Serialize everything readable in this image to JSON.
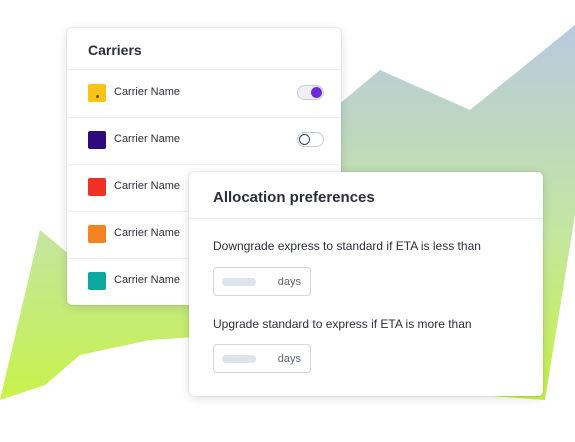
{
  "carriers": {
    "title": "Carriers",
    "items": [
      {
        "label": "Carrier Name",
        "color": "#f9c417",
        "toggle": true
      },
      {
        "label": "Carrier Name",
        "color": "#2e0a7d",
        "toggle": false
      },
      {
        "label": "Carrier Name",
        "color": "#ee3124"
      },
      {
        "label": "Carrier Name",
        "color": "#f58220"
      },
      {
        "label": "Carrier Name",
        "color": "#0aa89e"
      }
    ]
  },
  "allocation": {
    "title": "Allocation preferences",
    "downgrade_label": "Downgrade express to standard if ETA is less than",
    "downgrade_unit": "days",
    "upgrade_label": "Upgrade standard to express if ETA is more than",
    "upgrade_unit": "days"
  },
  "colors": {
    "toggle_on": "#6d2bd9",
    "bg_gradient_top": "#b8c9e0",
    "bg_gradient_bottom": "#c5f542"
  }
}
